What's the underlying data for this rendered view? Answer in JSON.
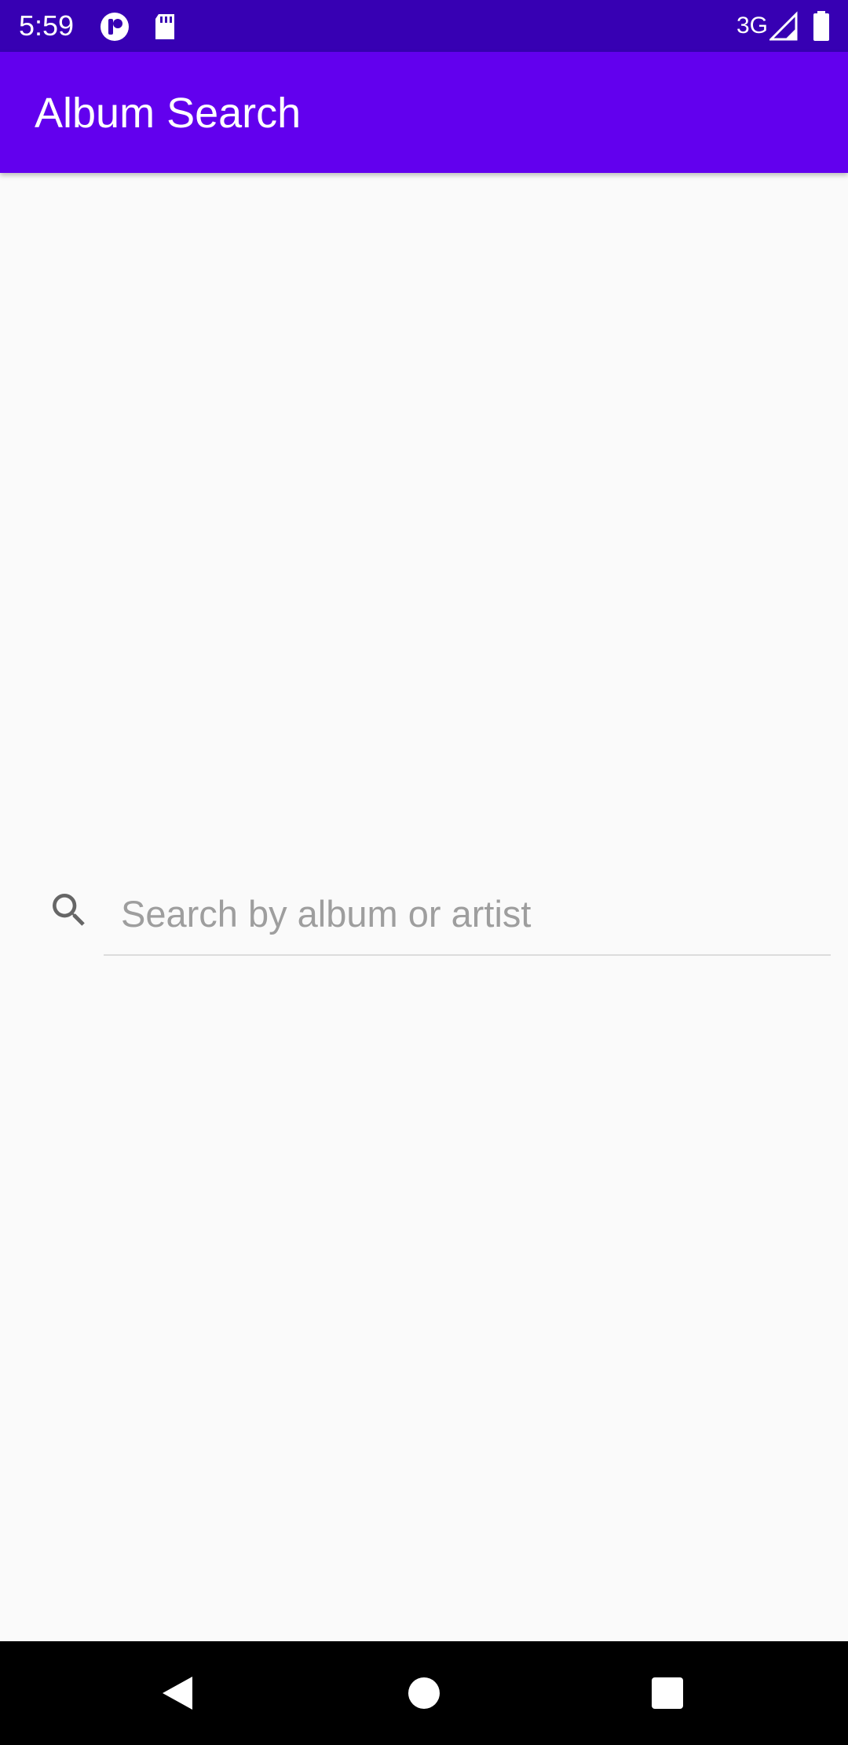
{
  "status_bar": {
    "time": "5:59",
    "network": "3G",
    "icons": [
      "notification-app-icon",
      "sd-card-icon",
      "signal-icon",
      "battery-icon"
    ]
  },
  "app_bar": {
    "title": "Album Search"
  },
  "search": {
    "placeholder": "Search by album or artist",
    "value": "",
    "icon": "search-icon"
  },
  "nav_bar": {
    "buttons": [
      "back-icon",
      "home-icon",
      "recents-icon"
    ]
  },
  "colors": {
    "primary": "#6200ee",
    "primary_dark": "#3700b3",
    "background": "#fafafa"
  }
}
